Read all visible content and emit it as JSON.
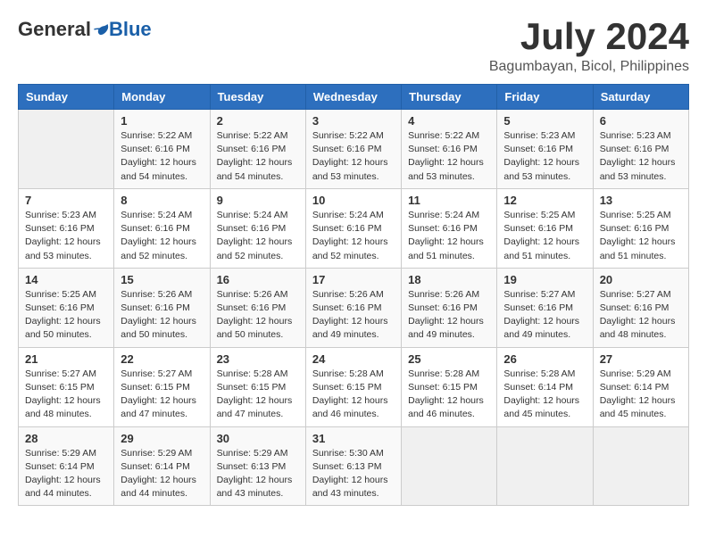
{
  "logo": {
    "general": "General",
    "blue": "Blue"
  },
  "title": {
    "month_year": "July 2024",
    "location": "Bagumbayan, Bicol, Philippines"
  },
  "weekdays": [
    "Sunday",
    "Monday",
    "Tuesday",
    "Wednesday",
    "Thursday",
    "Friday",
    "Saturday"
  ],
  "weeks": [
    [
      {
        "day": "",
        "sunrise": "",
        "sunset": "",
        "daylight": ""
      },
      {
        "day": "1",
        "sunrise": "Sunrise: 5:22 AM",
        "sunset": "Sunset: 6:16 PM",
        "daylight": "Daylight: 12 hours and 54 minutes."
      },
      {
        "day": "2",
        "sunrise": "Sunrise: 5:22 AM",
        "sunset": "Sunset: 6:16 PM",
        "daylight": "Daylight: 12 hours and 54 minutes."
      },
      {
        "day": "3",
        "sunrise": "Sunrise: 5:22 AM",
        "sunset": "Sunset: 6:16 PM",
        "daylight": "Daylight: 12 hours and 53 minutes."
      },
      {
        "day": "4",
        "sunrise": "Sunrise: 5:22 AM",
        "sunset": "Sunset: 6:16 PM",
        "daylight": "Daylight: 12 hours and 53 minutes."
      },
      {
        "day": "5",
        "sunrise": "Sunrise: 5:23 AM",
        "sunset": "Sunset: 6:16 PM",
        "daylight": "Daylight: 12 hours and 53 minutes."
      },
      {
        "day": "6",
        "sunrise": "Sunrise: 5:23 AM",
        "sunset": "Sunset: 6:16 PM",
        "daylight": "Daylight: 12 hours and 53 minutes."
      }
    ],
    [
      {
        "day": "7",
        "sunrise": "Sunrise: 5:23 AM",
        "sunset": "Sunset: 6:16 PM",
        "daylight": "Daylight: 12 hours and 53 minutes."
      },
      {
        "day": "8",
        "sunrise": "Sunrise: 5:24 AM",
        "sunset": "Sunset: 6:16 PM",
        "daylight": "Daylight: 12 hours and 52 minutes."
      },
      {
        "day": "9",
        "sunrise": "Sunrise: 5:24 AM",
        "sunset": "Sunset: 6:16 PM",
        "daylight": "Daylight: 12 hours and 52 minutes."
      },
      {
        "day": "10",
        "sunrise": "Sunrise: 5:24 AM",
        "sunset": "Sunset: 6:16 PM",
        "daylight": "Daylight: 12 hours and 52 minutes."
      },
      {
        "day": "11",
        "sunrise": "Sunrise: 5:24 AM",
        "sunset": "Sunset: 6:16 PM",
        "daylight": "Daylight: 12 hours and 51 minutes."
      },
      {
        "day": "12",
        "sunrise": "Sunrise: 5:25 AM",
        "sunset": "Sunset: 6:16 PM",
        "daylight": "Daylight: 12 hours and 51 minutes."
      },
      {
        "day": "13",
        "sunrise": "Sunrise: 5:25 AM",
        "sunset": "Sunset: 6:16 PM",
        "daylight": "Daylight: 12 hours and 51 minutes."
      }
    ],
    [
      {
        "day": "14",
        "sunrise": "Sunrise: 5:25 AM",
        "sunset": "Sunset: 6:16 PM",
        "daylight": "Daylight: 12 hours and 50 minutes."
      },
      {
        "day": "15",
        "sunrise": "Sunrise: 5:26 AM",
        "sunset": "Sunset: 6:16 PM",
        "daylight": "Daylight: 12 hours and 50 minutes."
      },
      {
        "day": "16",
        "sunrise": "Sunrise: 5:26 AM",
        "sunset": "Sunset: 6:16 PM",
        "daylight": "Daylight: 12 hours and 50 minutes."
      },
      {
        "day": "17",
        "sunrise": "Sunrise: 5:26 AM",
        "sunset": "Sunset: 6:16 PM",
        "daylight": "Daylight: 12 hours and 49 minutes."
      },
      {
        "day": "18",
        "sunrise": "Sunrise: 5:26 AM",
        "sunset": "Sunset: 6:16 PM",
        "daylight": "Daylight: 12 hours and 49 minutes."
      },
      {
        "day": "19",
        "sunrise": "Sunrise: 5:27 AM",
        "sunset": "Sunset: 6:16 PM",
        "daylight": "Daylight: 12 hours and 49 minutes."
      },
      {
        "day": "20",
        "sunrise": "Sunrise: 5:27 AM",
        "sunset": "Sunset: 6:16 PM",
        "daylight": "Daylight: 12 hours and 48 minutes."
      }
    ],
    [
      {
        "day": "21",
        "sunrise": "Sunrise: 5:27 AM",
        "sunset": "Sunset: 6:15 PM",
        "daylight": "Daylight: 12 hours and 48 minutes."
      },
      {
        "day": "22",
        "sunrise": "Sunrise: 5:27 AM",
        "sunset": "Sunset: 6:15 PM",
        "daylight": "Daylight: 12 hours and 47 minutes."
      },
      {
        "day": "23",
        "sunrise": "Sunrise: 5:28 AM",
        "sunset": "Sunset: 6:15 PM",
        "daylight": "Daylight: 12 hours and 47 minutes."
      },
      {
        "day": "24",
        "sunrise": "Sunrise: 5:28 AM",
        "sunset": "Sunset: 6:15 PM",
        "daylight": "Daylight: 12 hours and 46 minutes."
      },
      {
        "day": "25",
        "sunrise": "Sunrise: 5:28 AM",
        "sunset": "Sunset: 6:15 PM",
        "daylight": "Daylight: 12 hours and 46 minutes."
      },
      {
        "day": "26",
        "sunrise": "Sunrise: 5:28 AM",
        "sunset": "Sunset: 6:14 PM",
        "daylight": "Daylight: 12 hours and 45 minutes."
      },
      {
        "day": "27",
        "sunrise": "Sunrise: 5:29 AM",
        "sunset": "Sunset: 6:14 PM",
        "daylight": "Daylight: 12 hours and 45 minutes."
      }
    ],
    [
      {
        "day": "28",
        "sunrise": "Sunrise: 5:29 AM",
        "sunset": "Sunset: 6:14 PM",
        "daylight": "Daylight: 12 hours and 44 minutes."
      },
      {
        "day": "29",
        "sunrise": "Sunrise: 5:29 AM",
        "sunset": "Sunset: 6:14 PM",
        "daylight": "Daylight: 12 hours and 44 minutes."
      },
      {
        "day": "30",
        "sunrise": "Sunrise: 5:29 AM",
        "sunset": "Sunset: 6:13 PM",
        "daylight": "Daylight: 12 hours and 43 minutes."
      },
      {
        "day": "31",
        "sunrise": "Sunrise: 5:30 AM",
        "sunset": "Sunset: 6:13 PM",
        "daylight": "Daylight: 12 hours and 43 minutes."
      },
      {
        "day": "",
        "sunrise": "",
        "sunset": "",
        "daylight": ""
      },
      {
        "day": "",
        "sunrise": "",
        "sunset": "",
        "daylight": ""
      },
      {
        "day": "",
        "sunrise": "",
        "sunset": "",
        "daylight": ""
      }
    ]
  ]
}
